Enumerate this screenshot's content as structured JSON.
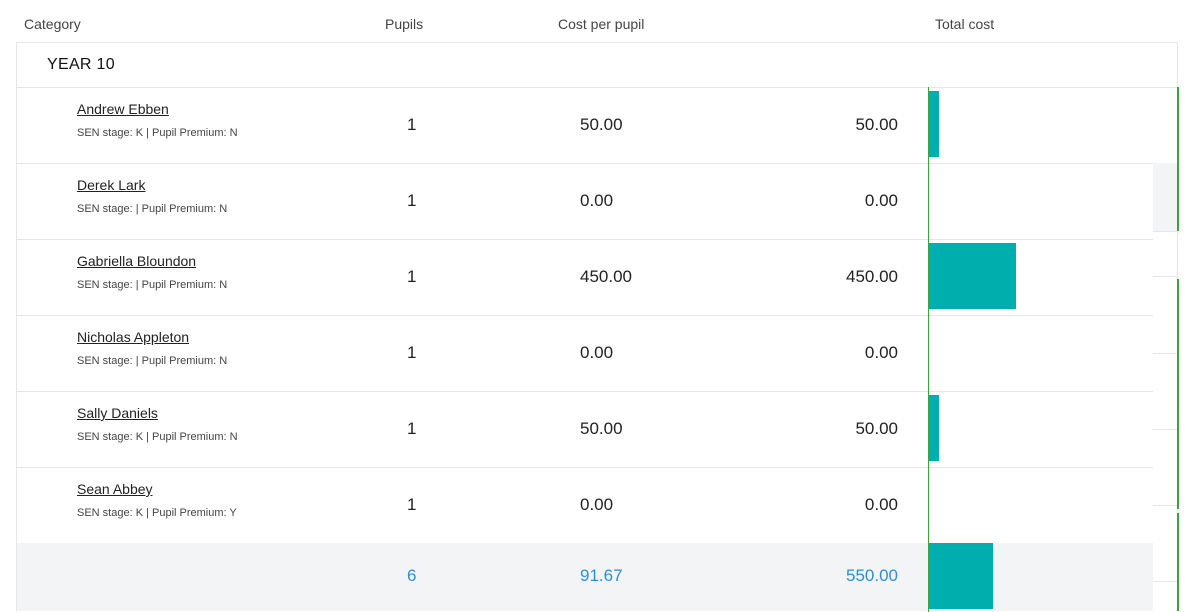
{
  "headers": {
    "category": "Category",
    "pupils": "Pupils",
    "cost_per_pupil": "Cost per pupil",
    "total_cost": "Total cost"
  },
  "group": {
    "label": "YEAR 10"
  },
  "rows": [
    {
      "name": "Andrew Ebben",
      "meta": "SEN stage: K | Pupil Premium: N",
      "pupils": "1",
      "cost_per_pupil": "50.00",
      "total_cost": "50.00",
      "bar_value": 50
    },
    {
      "name": "Derek Lark",
      "meta": "SEN stage: | Pupil Premium: N",
      "pupils": "1",
      "cost_per_pupil": "0.00",
      "total_cost": "0.00",
      "bar_value": 0
    },
    {
      "name": "Gabriella Bloundon",
      "meta": "SEN stage: | Pupil Premium: N",
      "pupils": "1",
      "cost_per_pupil": "450.00",
      "total_cost": "450.00",
      "bar_value": 450
    },
    {
      "name": "Nicholas Appleton",
      "meta": "SEN stage: | Pupil Premium: N",
      "pupils": "1",
      "cost_per_pupil": "0.00",
      "total_cost": "0.00",
      "bar_value": 0
    },
    {
      "name": "Sally Daniels",
      "meta": "SEN stage: K | Pupil Premium: N",
      "pupils": "1",
      "cost_per_pupil": "50.00",
      "total_cost": "50.00",
      "bar_value": 50
    },
    {
      "name": "Sean Abbey",
      "meta": "SEN stage: K | Pupil Premium: Y",
      "pupils": "1",
      "cost_per_pupil": "0.00",
      "total_cost": "0.00",
      "bar_value": 0
    }
  ],
  "totals": {
    "pupils": "6",
    "cost_per_pupil": "91.67",
    "total_cost": "550.00",
    "bar_value": 550
  },
  "colors": {
    "bar": "#00aeae",
    "totals_text": "#2d8fd5",
    "axis_line": "#3aa63a"
  }
}
